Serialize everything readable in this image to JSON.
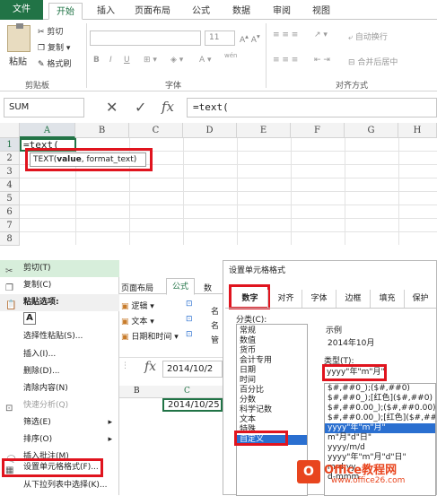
{
  "ribbon": {
    "tabs": [
      "文件",
      "开始",
      "插入",
      "页面布局",
      "公式",
      "数据",
      "审阅",
      "视图"
    ],
    "clipboard": {
      "paste": "粘贴",
      "cut": "剪切",
      "copy": "复制",
      "format_painter": "格式刷",
      "group_label": "剪贴板"
    },
    "font": {
      "size": "11",
      "bold": "B",
      "italic": "I",
      "underline": "U",
      "group_label": "字体",
      "wen": "wén"
    },
    "align": {
      "wrap": "自动换行",
      "merge": "合并后居中",
      "group_label": "对齐方式"
    }
  },
  "formula_bar": {
    "name_box": "SUM",
    "cancel": "✕",
    "enter": "✓",
    "fx": "fx",
    "content": "=text("
  },
  "grid": {
    "columns": [
      "A",
      "B",
      "C",
      "D",
      "E",
      "F",
      "G",
      "H"
    ],
    "rows": [
      "1",
      "2",
      "3",
      "4",
      "5",
      "6",
      "7",
      "8"
    ],
    "cell_a1": "=text(",
    "tooltip": {
      "fn": "TEXT(",
      "arg1": "value",
      "rest": ", format_text)"
    }
  },
  "context_menu": {
    "items": [
      "剪切(T)",
      "复制(C)",
      "粘贴选项:",
      "选择性粘贴(S)...",
      "插入(I)...",
      "删除(D)...",
      "清除内容(N)",
      "快速分析(Q)",
      "筛选(E)",
      "排序(O)",
      "插入批注(M)",
      "设置单元格格式(F)...",
      "从下拉列表中选择(K)..."
    ],
    "paste_icon": "A"
  },
  "mid_ribbon": {
    "tabs": [
      "页面布局",
      "公式",
      "数"
    ],
    "funcs": [
      "逻辑",
      "文本",
      "日期和时间"
    ],
    "more": "⊡",
    "extra": "名",
    "extra2": "名",
    "extra3": "管",
    "fx": "fx",
    "cell_value": "2014/10/2",
    "col_b": "B",
    "col_c": "C",
    "cell_c": "2014/10/25"
  },
  "dialog": {
    "title": "设置单元格格式",
    "tabs": [
      "数字",
      "对齐",
      "字体",
      "边框",
      "填充",
      "保护"
    ],
    "category_label": "分类(C):",
    "categories": [
      "常规",
      "数值",
      "货币",
      "会计专用",
      "日期",
      "时间",
      "百分比",
      "分数",
      "科学记数",
      "文本",
      "特殊",
      "自定义"
    ],
    "sample_label": "示例",
    "sample_value": "2014年10月",
    "type_label": "类型(T):",
    "type_value": "yyyy\"年\"m\"月\"",
    "formats": [
      "$#,##0_);($#,##0)",
      "$#,##0_);[红色]($#,##0)",
      "$#,##0.00_);($#,##0.00)",
      "$#,##0.00_);[红色]($#,##0.00)",
      "yyyy\"年\"m\"月\"",
      "m\"月\"d\"日\"",
      "yyyy/m/d",
      "yyyy\"年\"m\"月\"d\"日\"",
      "m-d-yy",
      "d-mmm"
    ],
    "watermark": {
      "brand": "Office教程网",
      "url": "www.office26.com"
    }
  }
}
